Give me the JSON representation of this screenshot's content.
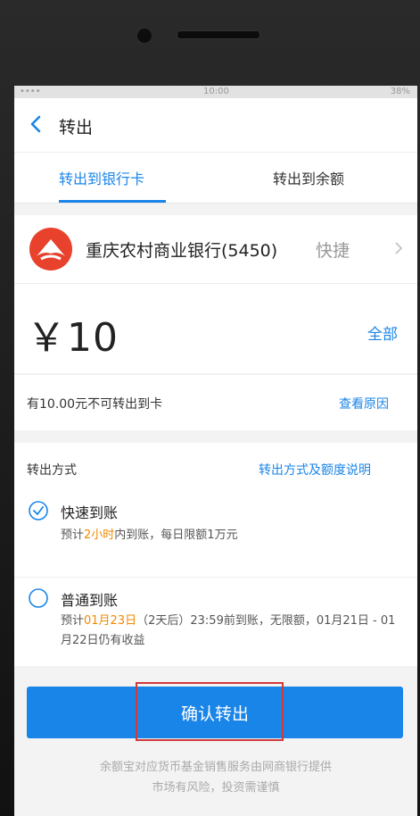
{
  "statusbar": {
    "carrier": "••••",
    "time": "10:00",
    "battery": "38%"
  },
  "nav": {
    "title": "转出",
    "back_icon": "chevron-left-icon"
  },
  "tabs": [
    {
      "label": "转出到银行卡",
      "active": true
    },
    {
      "label": "转出到余额",
      "active": false
    }
  ],
  "bank": {
    "name": "重庆农村商业银行(5450)",
    "tag": "快捷",
    "logo_color": "#e8412c"
  },
  "amount": {
    "value": "￥10",
    "all_label": "全部"
  },
  "note": {
    "text": "有10.00元不可转出到卡",
    "link": "查看原因"
  },
  "method": {
    "label": "转出方式",
    "link": "转出方式及额度说明",
    "options": [
      {
        "title": "快速到账",
        "checked": true,
        "desc_prefix": "预计",
        "desc_highlight": "2小时",
        "desc_suffix": "内到账，每日限额1万元"
      },
      {
        "title": "普通到账",
        "checked": false,
        "desc_prefix": "预计",
        "desc_highlight": "01月23日",
        "desc_suffix": "（2天后）23:59前到账，无限额，01月21日 - 01月22日仍有收益"
      }
    ]
  },
  "confirm_label": "确认转出",
  "footer": {
    "line1": "余额宝对应货币基金销售服务由网商银行提供",
    "line2": "市场有风险，投资需谨慎"
  },
  "colors": {
    "accent": "#1a85e8",
    "highlight_text": "#f08a00",
    "annotation_box": "#d23a3a"
  }
}
